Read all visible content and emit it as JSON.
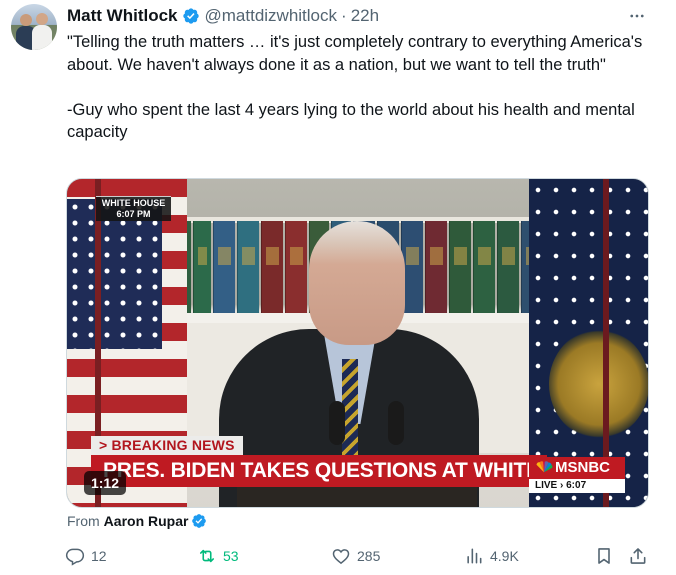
{
  "tweet": {
    "author_name": "Matt Whitlock",
    "author_handle": "@mattdizwhitlock",
    "separator": "·",
    "time": "22h",
    "text": "\"Telling the truth matters … it's just completely contrary to everything America's about. We haven't always done it as a nation, but we want to tell the truth\"\n\n-Guy who spent the last 4 years lying to the world about his health and mental capacity"
  },
  "video": {
    "bug_line1": "WHITE HOUSE",
    "bug_line2": "6:07 PM",
    "breaking": "> BREAKING NEWS",
    "chyron": "PRES. BIDEN TAKES QUESTIONS AT WHITE HOUSE",
    "network": "MSNBC",
    "live": "LIVE  ›  6:07",
    "duration": "1:12"
  },
  "source": {
    "prefix": "From",
    "name": "Aaron Rupar"
  },
  "actions": {
    "reply_count": "12",
    "retweet_count": "53",
    "like_count": "285",
    "view_count": "4.9K"
  },
  "colors": {
    "verified_blue": "#1d9bf0",
    "retweet_green": "#00ba7c",
    "secondary_text": "#536471",
    "chyron_red": "#bf1a22"
  },
  "icons": [
    "verified-badge-icon",
    "more-icon",
    "reply-icon",
    "retweet-icon",
    "like-icon",
    "views-icon",
    "bookmark-icon",
    "share-icon"
  ]
}
